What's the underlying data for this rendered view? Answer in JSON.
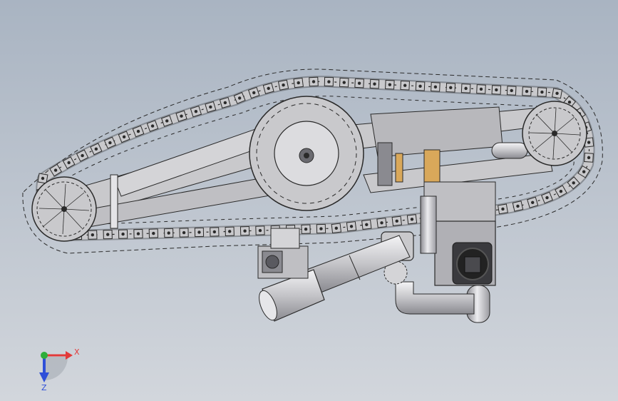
{
  "viewport": {
    "background_top": "#a9b4c2",
    "background_bottom": "#d2d6dc"
  },
  "model": {
    "part_color": "#c9c9cc",
    "edge_color": "#2a2a2a",
    "accent_color": "#d9a85a"
  },
  "triad": {
    "x_label": "X",
    "z_label": "Z",
    "x_color": "#e23a3a",
    "y_color": "#2fae3a",
    "z_color": "#2f4fd8"
  }
}
